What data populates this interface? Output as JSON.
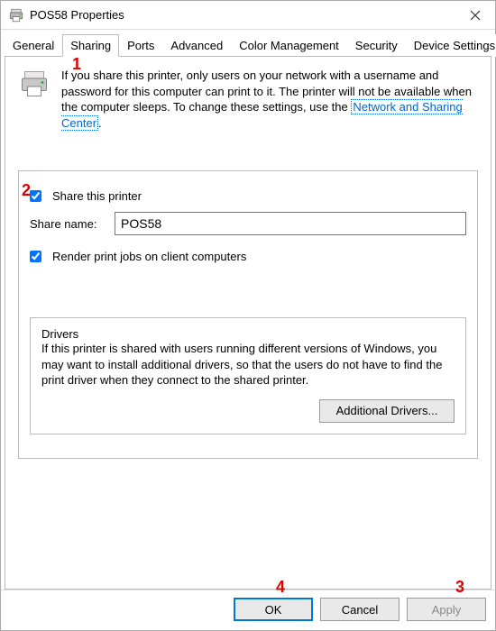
{
  "window": {
    "title": "POS58 Properties"
  },
  "tabs": [
    {
      "id": "general",
      "label": "General"
    },
    {
      "id": "sharing",
      "label": "Sharing"
    },
    {
      "id": "ports",
      "label": "Ports"
    },
    {
      "id": "advanced",
      "label": "Advanced"
    },
    {
      "id": "colormgmt",
      "label": "Color Management"
    },
    {
      "id": "security",
      "label": "Security"
    },
    {
      "id": "device",
      "label": "Device Settings"
    }
  ],
  "active_tab": "sharing",
  "sharing": {
    "intro_text_prefix": "If you share this printer, only users on your network with a username and password for this computer can print to it. The printer will not be available when the computer sleeps. To change these settings, use the ",
    "intro_link_text": "Network and Sharing Center",
    "share_this_printer_label": "Share this printer",
    "share_this_printer_checked": true,
    "share_name_label": "Share name:",
    "share_name_value": "POS58",
    "render_client_label": "Render print jobs on client computers",
    "render_client_checked": true,
    "drivers_group_label": "Drivers",
    "drivers_text": "If this printer is shared with users running different versions of Windows, you may want to install additional drivers, so that the users do not have to find the print driver when they connect to the shared printer.",
    "additional_drivers_label": "Additional Drivers..."
  },
  "buttons": {
    "ok": "OK",
    "cancel": "Cancel",
    "apply": "Apply"
  },
  "callouts": {
    "c1": "1",
    "c2": "2",
    "c3": "3",
    "c4": "4"
  }
}
